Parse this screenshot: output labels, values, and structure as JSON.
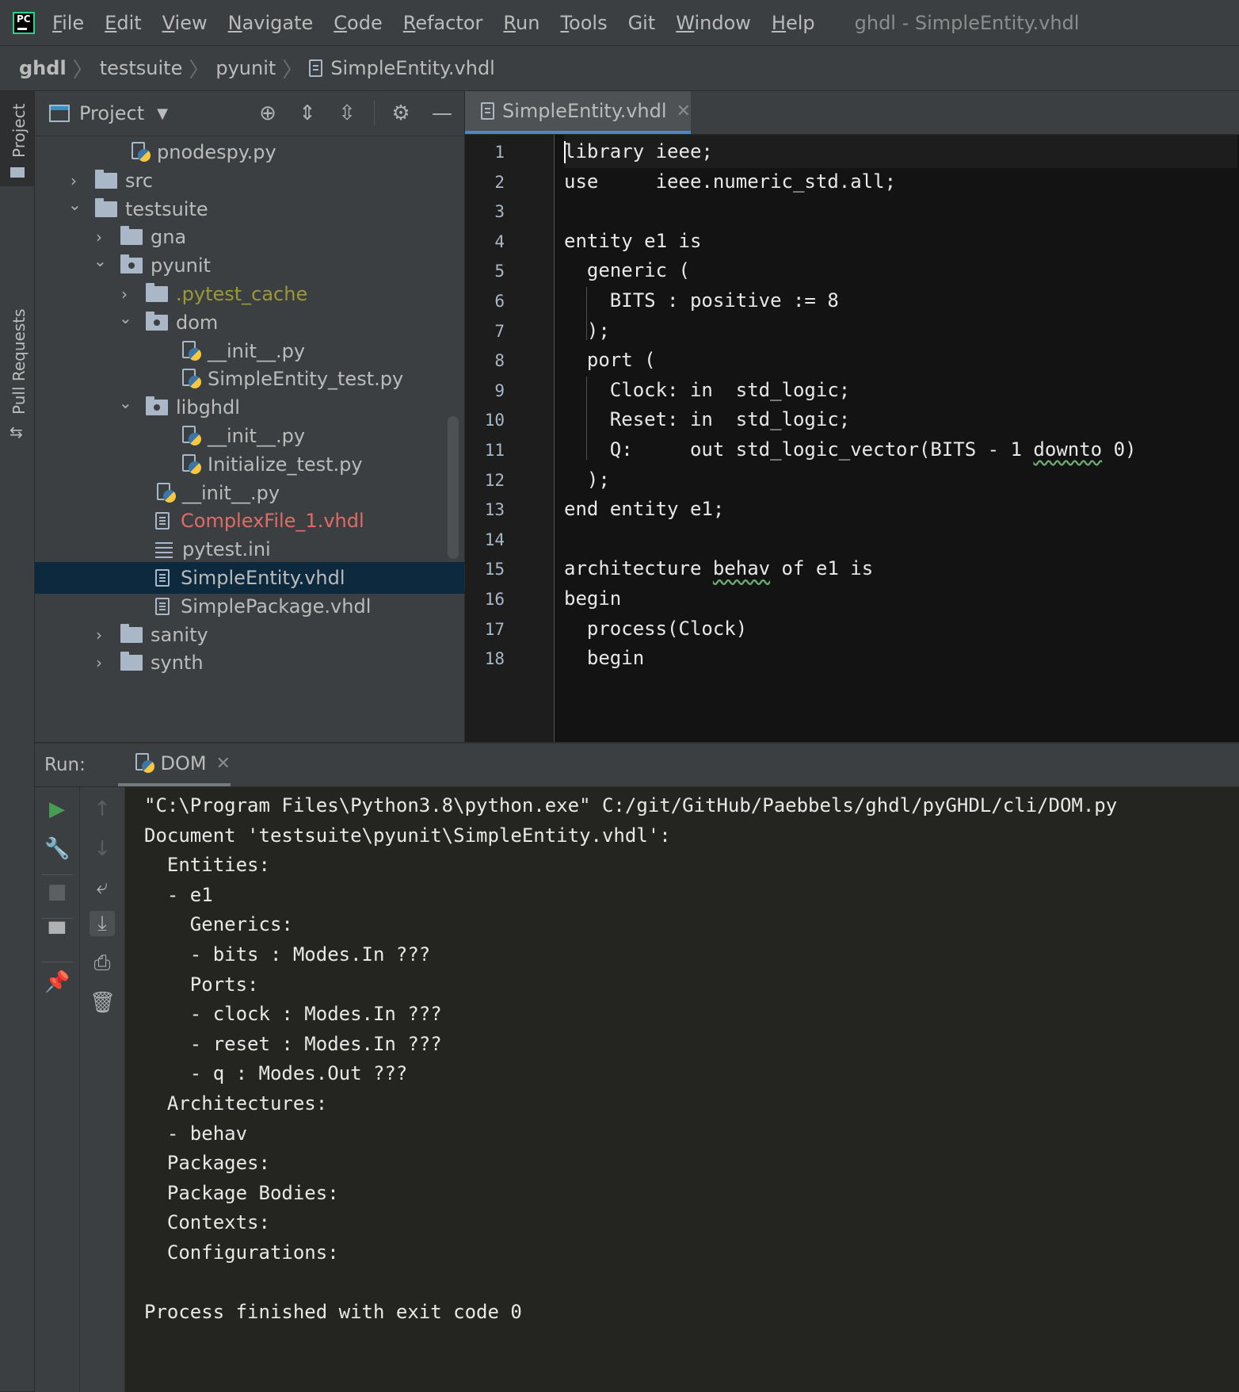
{
  "menubar": {
    "items": [
      {
        "first": "F",
        "rest": "ile"
      },
      {
        "first": "E",
        "rest": "dit"
      },
      {
        "first": "V",
        "rest": "iew"
      },
      {
        "first": "N",
        "rest": "avigate"
      },
      {
        "first": "C",
        "rest": "ode"
      },
      {
        "first": "R",
        "rest": "efactor"
      },
      {
        "first": "R",
        "rest": "un"
      },
      {
        "first": "T",
        "rest": "ools"
      },
      {
        "first": "",
        "rest": "Git"
      },
      {
        "first": "W",
        "rest": "indow"
      },
      {
        "first": "H",
        "rest": "elp"
      }
    ],
    "window_title": "ghdl - SimpleEntity.vhdl"
  },
  "breadcrumb": [
    "ghdl",
    "testsuite",
    "pyunit",
    "SimpleEntity.vhdl"
  ],
  "left_strip": {
    "project_tab": "Project",
    "pull_requests_tab": "Pull Requests"
  },
  "project_panel": {
    "title": "Project",
    "tree": [
      {
        "label": "pnodespy.py",
        "type": "py",
        "depth": 3
      },
      {
        "label": "src",
        "type": "folder",
        "depth": 1,
        "expanded": false
      },
      {
        "label": "testsuite",
        "type": "folder",
        "depth": 1,
        "expanded": true
      },
      {
        "label": "gna",
        "type": "folder",
        "depth": 2,
        "expanded": false
      },
      {
        "label": "pyunit",
        "type": "package",
        "depth": 2,
        "expanded": true
      },
      {
        "label": ".pytest_cache",
        "type": "folder",
        "depth": 3,
        "expanded": false,
        "status": "ignored"
      },
      {
        "label": "dom",
        "type": "package",
        "depth": 3,
        "expanded": true
      },
      {
        "label": "__init__.py",
        "type": "py",
        "depth": 5
      },
      {
        "label": "SimpleEntity_test.py",
        "type": "py",
        "depth": 5
      },
      {
        "label": "libghdl",
        "type": "package",
        "depth": 3,
        "expanded": true
      },
      {
        "label": "__init__.py",
        "type": "py",
        "depth": 5
      },
      {
        "label": "Initialize_test.py",
        "type": "py",
        "depth": 5
      },
      {
        "label": "__init__.py",
        "type": "py",
        "depth": 4
      },
      {
        "label": "ComplexFile_1.vhdl",
        "type": "txt",
        "depth": 4,
        "status": "modified"
      },
      {
        "label": "pytest.ini",
        "type": "ini",
        "depth": 4
      },
      {
        "label": "SimpleEntity.vhdl",
        "type": "txt",
        "depth": 4,
        "selected": true
      },
      {
        "label": "SimplePackage.vhdl",
        "type": "txt",
        "depth": 4
      },
      {
        "label": "sanity",
        "type": "folder",
        "depth": 2,
        "expanded": false
      },
      {
        "label": "synth",
        "type": "folder",
        "depth": 2,
        "expanded": false
      }
    ]
  },
  "editor": {
    "tab_label": "SimpleEntity.vhdl",
    "lines": [
      "library ieee;",
      "use     ieee.numeric_std.all;",
      "",
      "entity e1 is",
      "  generic (",
      "    BITS : positive := 8",
      "  );",
      "  port (",
      "    Clock: in  std_logic;",
      "    Reset: in  std_logic;",
      "    Q:     out std_logic_vector(BITS - 1 downto 0)",
      "  );",
      "end entity e1;",
      "",
      "architecture behav of e1 is",
      "begin",
      "  process(Clock)",
      "  begin"
    ],
    "line_numbers": [
      "1",
      "2",
      "3",
      "4",
      "5",
      "6",
      "7",
      "8",
      "9",
      "10",
      "11",
      "12",
      "13",
      "14",
      "15",
      "16",
      "17",
      "18"
    ]
  },
  "run_panel": {
    "label": "Run:",
    "tab_label": "DOM",
    "output": [
      "\"C:\\Program Files\\Python3.8\\python.exe\" C:/git/GitHub/Paebbels/ghdl/pyGHDL/cli/DOM.py",
      "Document 'testsuite\\pyunit\\SimpleEntity.vhdl':",
      "  Entities:",
      "  - e1",
      "    Generics:",
      "    - bits : Modes.In ???",
      "    Ports:",
      "    - clock : Modes.In ???",
      "    - reset : Modes.In ???",
      "    - q : Modes.Out ???",
      "  Architectures:",
      "  - behav",
      "  Packages:",
      "  Package Bodies:",
      "  Contexts:",
      "  Configurations:",
      "",
      "Process finished with exit code 0"
    ]
  },
  "colors": {
    "accent": "#4a88c7",
    "selection": "#0d293e",
    "modified": "#e06c67",
    "ignored": "#b3b033"
  }
}
